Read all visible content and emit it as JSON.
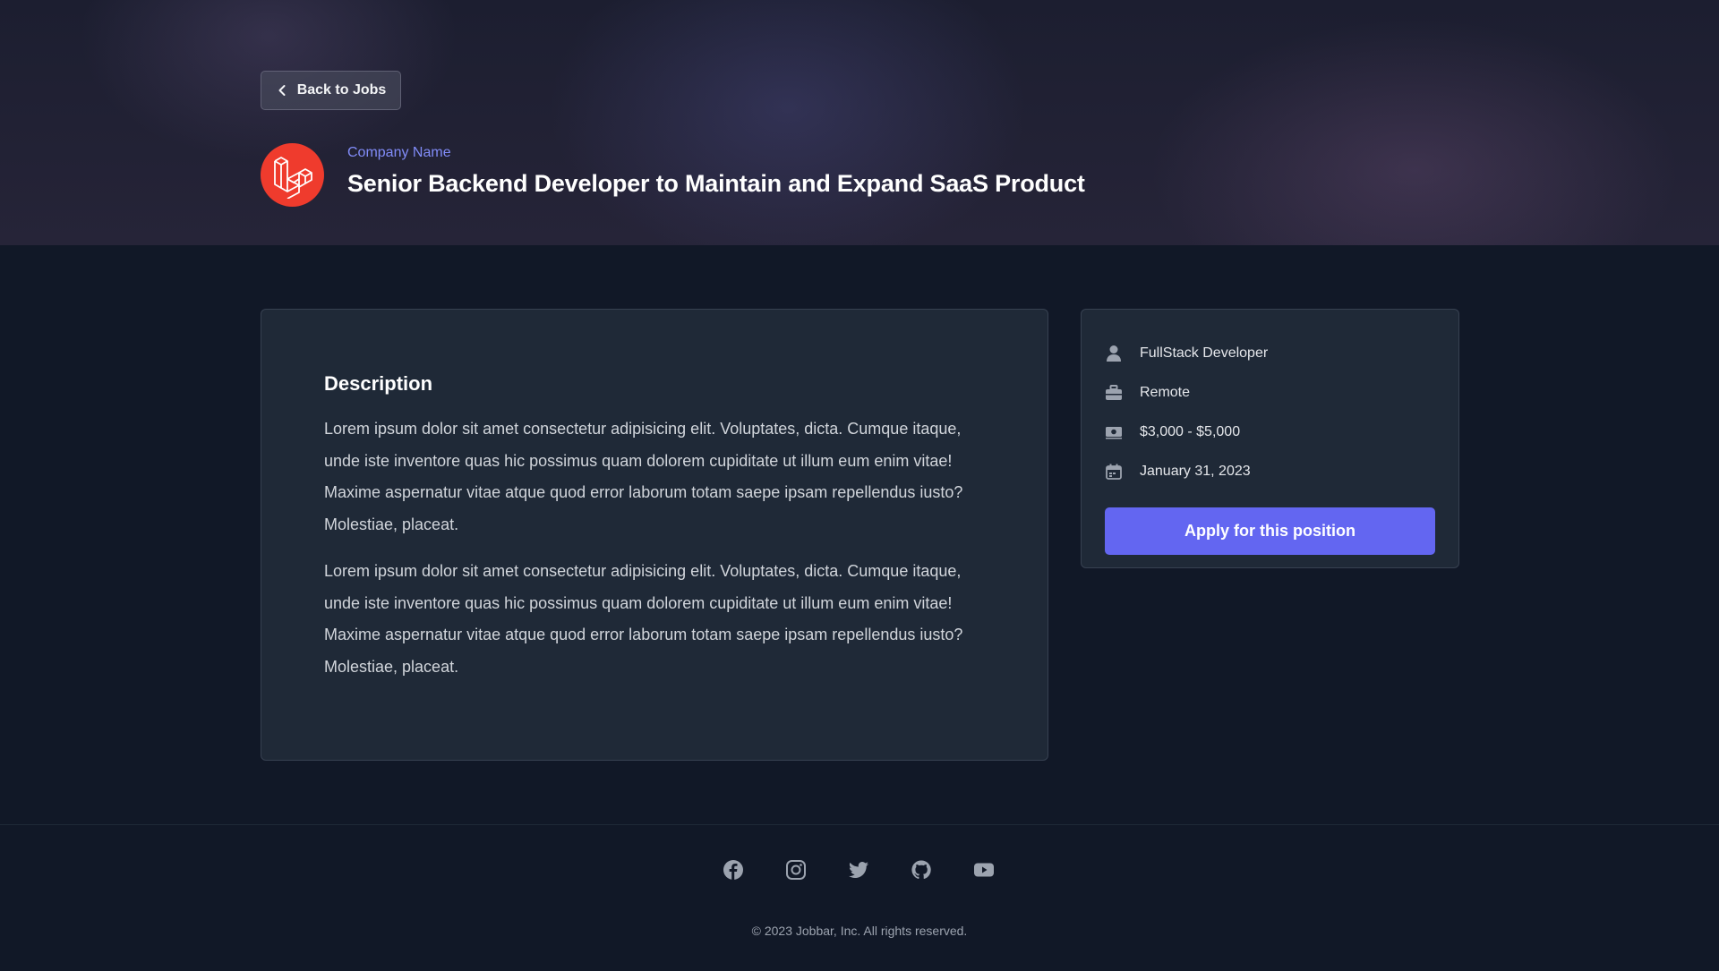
{
  "header": {
    "back_label": "Back to Jobs",
    "company_name": "Company Name",
    "job_title": "Senior Backend Developer to Maintain and Expand SaaS Product",
    "logo_color": "#ef3b2d"
  },
  "description": {
    "heading": "Description",
    "paragraphs": [
      "Lorem ipsum dolor sit amet consectetur adipisicing elit. Voluptates, dicta. Cumque itaque, unde iste inventore quas hic possimus quam dolorem cupiditate ut illum eum enim vitae! Maxime aspernatur vitae atque quod error laborum totam saepe ipsam repellendus iusto? Molestiae, placeat.",
      "Lorem ipsum dolor sit amet consectetur adipisicing elit. Voluptates, dicta. Cumque itaque, unde iste inventore quas hic possimus quam dolorem cupiditate ut illum eum enim vitae! Maxime aspernatur vitae atque quod error laborum totam saepe ipsam repellendus iusto? Molestiae, placeat."
    ]
  },
  "details": {
    "items": [
      {
        "icon": "user-icon",
        "text": "FullStack Developer"
      },
      {
        "icon": "briefcase-icon",
        "text": "Remote"
      },
      {
        "icon": "money-icon",
        "text": "$3,000 - $5,000"
      },
      {
        "icon": "calendar-icon",
        "text": "January 31, 2023"
      }
    ],
    "apply_label": "Apply for this position",
    "accent_color": "#6366f1"
  },
  "footer": {
    "socials": [
      "facebook-icon",
      "instagram-icon",
      "twitter-icon",
      "github-icon",
      "youtube-icon"
    ],
    "copyright": "© 2023 Jobbar, Inc. All rights reserved."
  }
}
